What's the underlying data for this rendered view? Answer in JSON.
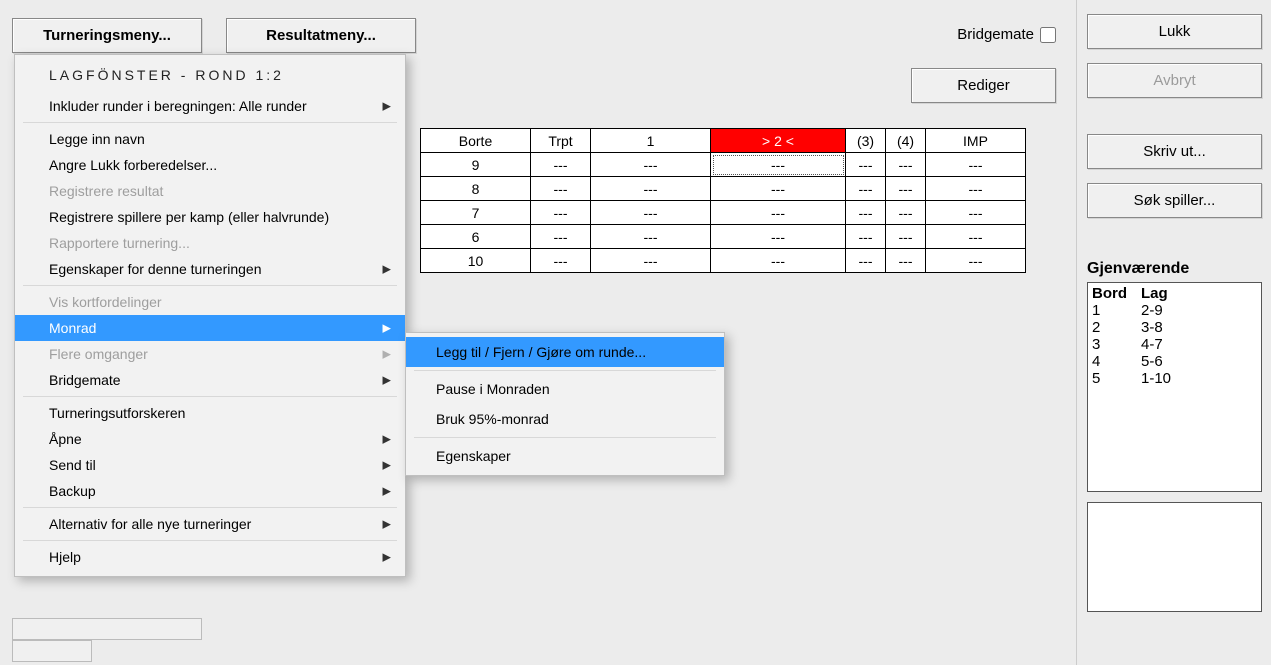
{
  "topButtons": {
    "tournament": "Turneringsmeny...",
    "result": "Resultatmeny..."
  },
  "bridgemate": {
    "label": "Bridgemate",
    "checked": false
  },
  "edit": "Rediger",
  "right": {
    "close": "Lukk",
    "cancel": "Avbryt",
    "print": "Skriv ut...",
    "search": "Søk spiller...",
    "remainingTitle": "Gjenværende",
    "headers": {
      "bord": "Bord",
      "lag": "Lag"
    },
    "rows": [
      {
        "bord": "1",
        "lag": "2-9"
      },
      {
        "bord": "2",
        "lag": "3-8"
      },
      {
        "bord": "3",
        "lag": "4-7"
      },
      {
        "bord": "4",
        "lag": "5-6"
      },
      {
        "bord": "5",
        "lag": "1-10"
      }
    ]
  },
  "grid": {
    "headers": {
      "borte": "Borte",
      "trpt": "Trpt",
      "c1": "1",
      "c2": "> 2 <",
      "c3": "(3)",
      "c4": "(4)",
      "imp": "IMP"
    },
    "rows": [
      {
        "borte": "9",
        "trpt": "---",
        "c1": "---",
        "c2": "---",
        "c3": "---",
        "c4": "---",
        "imp": "---"
      },
      {
        "borte": "8",
        "trpt": "---",
        "c1": "---",
        "c2": "---",
        "c3": "---",
        "c4": "---",
        "imp": "---"
      },
      {
        "borte": "7",
        "trpt": "---",
        "c1": "---",
        "c2": "---",
        "c3": "---",
        "c4": "---",
        "imp": "---"
      },
      {
        "borte": "6",
        "trpt": "---",
        "c1": "---",
        "c2": "---",
        "c3": "---",
        "c4": "---",
        "imp": "---"
      },
      {
        "borte": "10",
        "trpt": "---",
        "c1": "---",
        "c2": "---",
        "c3": "---",
        "c4": "---",
        "imp": "---"
      }
    ]
  },
  "menu": {
    "title": "LAGFÖNSTER - ROND 1:2",
    "items": [
      {
        "label": "Inkluder runder i beregningen:  Alle runder",
        "arrow": true
      },
      {
        "sep": true
      },
      {
        "label": "Legge inn navn"
      },
      {
        "label": "Angre Lukk forberedelser..."
      },
      {
        "label": "Registrere resultat",
        "disabled": true
      },
      {
        "label": "Registrere spillere per kamp (eller halvrunde)"
      },
      {
        "label": "Rapportere turnering...",
        "disabled": true
      },
      {
        "label": "Egenskaper for denne turneringen",
        "arrow": true
      },
      {
        "sep": true
      },
      {
        "label": "Vis kortfordelinger",
        "disabled": true
      },
      {
        "label": "Monrad",
        "arrow": true,
        "highlight": true
      },
      {
        "label": "Flere omganger",
        "disabled": true,
        "arrow": true
      },
      {
        "label": "Bridgemate",
        "arrow": true
      },
      {
        "sep": true
      },
      {
        "label": "Turneringsutforskeren"
      },
      {
        "label": "Åpne",
        "arrow": true
      },
      {
        "label": "Send til",
        "arrow": true
      },
      {
        "label": "Backup",
        "arrow": true
      },
      {
        "sep": true
      },
      {
        "label": "Alternativ for alle nye turneringer",
        "arrow": true
      },
      {
        "sep": true
      },
      {
        "label": "Hjelp",
        "arrow": true
      }
    ]
  },
  "submenu": {
    "items": [
      {
        "label": "Legg til / Fjern / Gjøre om runde...",
        "highlight": true
      },
      {
        "sep": true
      },
      {
        "label": "Pause i Monraden"
      },
      {
        "label": "Bruk 95%-monrad"
      },
      {
        "sep": true
      },
      {
        "label": "Egenskaper"
      }
    ]
  }
}
